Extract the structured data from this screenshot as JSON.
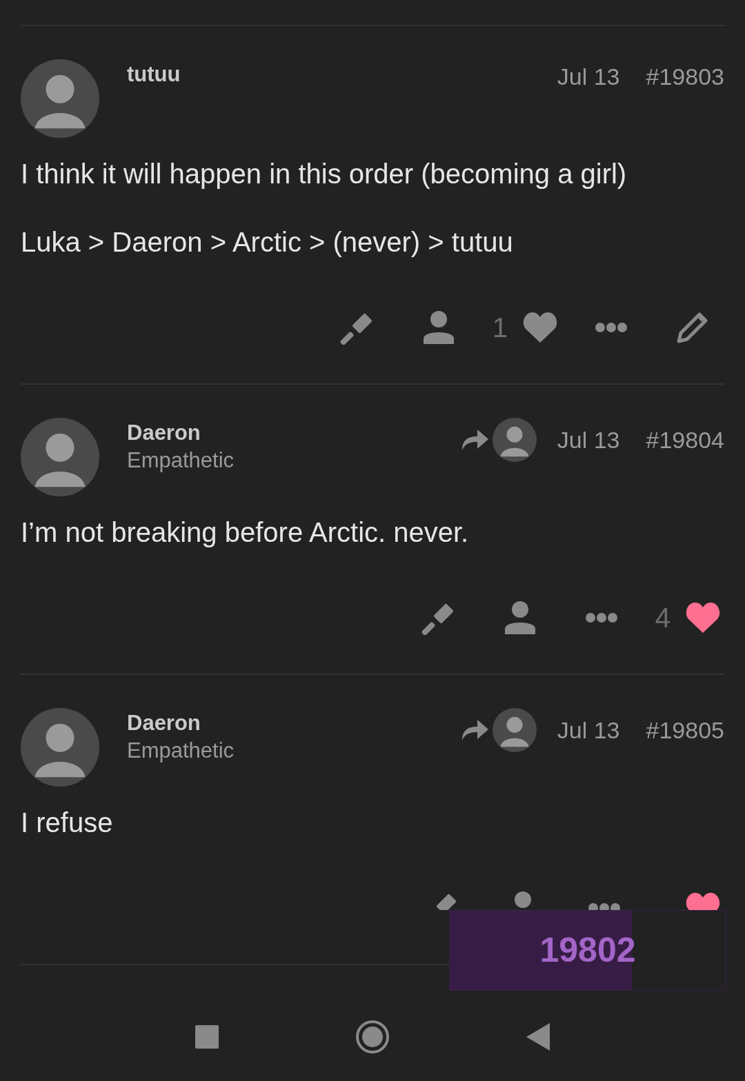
{
  "posts": [
    {
      "username": "tutuu",
      "reply_to": false,
      "date": "Jul 13",
      "number": "#19803",
      "paragraphs": [
        "I think it will happen in this order (becoming a girl)",
        "Luka > Daeron > Arctic > (never) > tutuu"
      ],
      "actions": [
        {
          "kind": "flag"
        },
        {
          "kind": "user"
        },
        {
          "kind": "like",
          "count": "1",
          "liked": false
        },
        {
          "kind": "more"
        },
        {
          "kind": "edit"
        }
      ]
    },
    {
      "username": "Daeron",
      "user_title": "Empathetic",
      "reply_to": true,
      "date": "Jul 13",
      "number": "#19804",
      "paragraphs": [
        "I’m not breaking before Arctic. never."
      ],
      "actions": [
        {
          "kind": "flag"
        },
        {
          "kind": "user"
        },
        {
          "kind": "more"
        },
        {
          "kind": "like",
          "count": "4",
          "liked": true
        }
      ]
    },
    {
      "username": "Daeron",
      "user_title": "Empathetic",
      "reply_to": true,
      "date": "Jul 13",
      "number": "#19805",
      "paragraphs": [
        "I refuse"
      ],
      "actions": [
        {
          "kind": "flag"
        },
        {
          "kind": "user"
        },
        {
          "kind": "more"
        },
        {
          "kind": "like",
          "liked": true
        }
      ]
    }
  ],
  "progress": {
    "post_number": "19802",
    "level": 0.66
  }
}
